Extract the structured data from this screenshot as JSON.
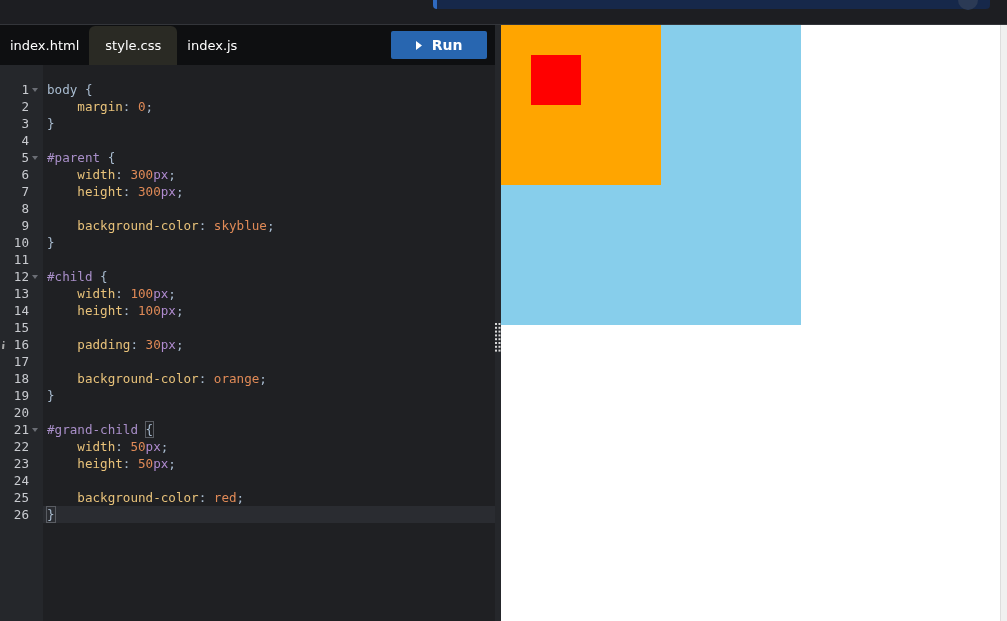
{
  "tabs": [
    {
      "label": "index.html",
      "selected": false
    },
    {
      "label": "style.css",
      "selected": true
    },
    {
      "label": "index.js",
      "selected": false
    }
  ],
  "run_button": {
    "label": "Run"
  },
  "editor": {
    "lines": [
      {
        "number": "1",
        "foldable": true,
        "active": false,
        "info": false,
        "indent": false,
        "tokens": [
          {
            "kind": "selector",
            "text": "body"
          },
          {
            "kind": "punct",
            "text": " {"
          }
        ]
      },
      {
        "number": "2",
        "foldable": false,
        "active": false,
        "info": false,
        "indent": true,
        "tokens": [
          {
            "kind": "property",
            "text": "margin"
          },
          {
            "kind": "punct",
            "text": ": "
          },
          {
            "kind": "number",
            "text": "0"
          },
          {
            "kind": "punct",
            "text": ";"
          }
        ]
      },
      {
        "number": "3",
        "foldable": false,
        "active": false,
        "info": false,
        "indent": false,
        "tokens": [
          {
            "kind": "punct",
            "text": "}"
          }
        ]
      },
      {
        "number": "4",
        "foldable": false,
        "active": false,
        "info": false
      },
      {
        "number": "5",
        "foldable": true,
        "active": false,
        "info": false,
        "indent": false,
        "tokens": [
          {
            "kind": "id",
            "text": "#parent"
          },
          {
            "kind": "punct",
            "text": " {"
          }
        ]
      },
      {
        "number": "6",
        "foldable": false,
        "active": false,
        "info": false,
        "indent": true,
        "tokens": [
          {
            "kind": "property",
            "text": "width"
          },
          {
            "kind": "punct",
            "text": ": "
          },
          {
            "kind": "number",
            "text": "300"
          },
          {
            "kind": "unit",
            "text": "px"
          },
          {
            "kind": "punct",
            "text": ";"
          }
        ]
      },
      {
        "number": "7",
        "foldable": false,
        "active": false,
        "info": false,
        "indent": true,
        "tokens": [
          {
            "kind": "property",
            "text": "height"
          },
          {
            "kind": "punct",
            "text": ": "
          },
          {
            "kind": "number",
            "text": "300"
          },
          {
            "kind": "unit",
            "text": "px"
          },
          {
            "kind": "punct",
            "text": ";"
          }
        ]
      },
      {
        "number": "8",
        "foldable": false,
        "active": false,
        "info": false
      },
      {
        "number": "9",
        "foldable": false,
        "active": false,
        "info": false,
        "indent": true,
        "tokens": [
          {
            "kind": "property",
            "text": "background-color"
          },
          {
            "kind": "punct",
            "text": ": "
          },
          {
            "kind": "keyword",
            "text": "skyblue"
          },
          {
            "kind": "punct",
            "text": ";"
          }
        ]
      },
      {
        "number": "10",
        "foldable": false,
        "active": false,
        "info": false,
        "indent": false,
        "tokens": [
          {
            "kind": "punct",
            "text": "}"
          }
        ]
      },
      {
        "number": "11",
        "foldable": false,
        "active": false,
        "info": false
      },
      {
        "number": "12",
        "foldable": true,
        "active": false,
        "info": false,
        "indent": false,
        "tokens": [
          {
            "kind": "id",
            "text": "#child"
          },
          {
            "kind": "punct",
            "text": " {"
          }
        ]
      },
      {
        "number": "13",
        "foldable": false,
        "active": false,
        "info": false,
        "indent": true,
        "tokens": [
          {
            "kind": "property",
            "text": "width"
          },
          {
            "kind": "punct",
            "text": ": "
          },
          {
            "kind": "number",
            "text": "100"
          },
          {
            "kind": "unit",
            "text": "px"
          },
          {
            "kind": "punct",
            "text": ";"
          }
        ]
      },
      {
        "number": "14",
        "foldable": false,
        "active": false,
        "info": false,
        "indent": true,
        "tokens": [
          {
            "kind": "property",
            "text": "height"
          },
          {
            "kind": "punct",
            "text": ": "
          },
          {
            "kind": "number",
            "text": "100"
          },
          {
            "kind": "unit",
            "text": "px"
          },
          {
            "kind": "punct",
            "text": ";"
          }
        ]
      },
      {
        "number": "15",
        "foldable": false,
        "active": false,
        "info": false
      },
      {
        "number": "16",
        "foldable": false,
        "active": false,
        "info": true,
        "indent": true,
        "tokens": [
          {
            "kind": "property",
            "text": "padding"
          },
          {
            "kind": "punct",
            "text": ": "
          },
          {
            "kind": "number",
            "text": "30"
          },
          {
            "kind": "unit",
            "text": "px"
          },
          {
            "kind": "punct",
            "text": ";"
          }
        ]
      },
      {
        "number": "17",
        "foldable": false,
        "active": false,
        "info": false
      },
      {
        "number": "18",
        "foldable": false,
        "active": false,
        "info": false,
        "indent": true,
        "tokens": [
          {
            "kind": "property",
            "text": "background-color"
          },
          {
            "kind": "punct",
            "text": ": "
          },
          {
            "kind": "keyword",
            "text": "orange"
          },
          {
            "kind": "punct",
            "text": ";"
          }
        ]
      },
      {
        "number": "19",
        "foldable": false,
        "active": false,
        "info": false,
        "indent": false,
        "tokens": [
          {
            "kind": "punct",
            "text": "}"
          }
        ]
      },
      {
        "number": "20",
        "foldable": false,
        "active": false,
        "info": false
      },
      {
        "number": "21",
        "foldable": true,
        "active": false,
        "info": false,
        "indent": false,
        "tokens": [
          {
            "kind": "id",
            "text": "#grand-child"
          },
          {
            "kind": "bracket",
            "text": "{"
          }
        ]
      },
      {
        "number": "22",
        "foldable": false,
        "active": false,
        "info": false,
        "indent": true,
        "tokens": [
          {
            "kind": "property",
            "text": "width"
          },
          {
            "kind": "punct",
            "text": ": "
          },
          {
            "kind": "number",
            "text": "50"
          },
          {
            "kind": "unit",
            "text": "px"
          },
          {
            "kind": "punct",
            "text": ";"
          }
        ]
      },
      {
        "number": "23",
        "foldable": false,
        "active": false,
        "info": false,
        "indent": true,
        "tokens": [
          {
            "kind": "property",
            "text": "height"
          },
          {
            "kind": "punct",
            "text": ": "
          },
          {
            "kind": "number",
            "text": "50"
          },
          {
            "kind": "unit",
            "text": "px"
          },
          {
            "kind": "punct",
            "text": ";"
          }
        ]
      },
      {
        "number": "24",
        "foldable": false,
        "active": false,
        "info": false
      },
      {
        "number": "25",
        "foldable": false,
        "active": false,
        "info": false,
        "indent": true,
        "tokens": [
          {
            "kind": "property",
            "text": "background-color"
          },
          {
            "kind": "punct",
            "text": ": "
          },
          {
            "kind": "keyword",
            "text": "red"
          },
          {
            "kind": "punct",
            "text": ";"
          }
        ]
      },
      {
        "number": "26",
        "foldable": false,
        "active": true,
        "info": false,
        "indent": false,
        "tokens": [
          {
            "kind": "bracket",
            "text": "}"
          }
        ]
      }
    ]
  }
}
